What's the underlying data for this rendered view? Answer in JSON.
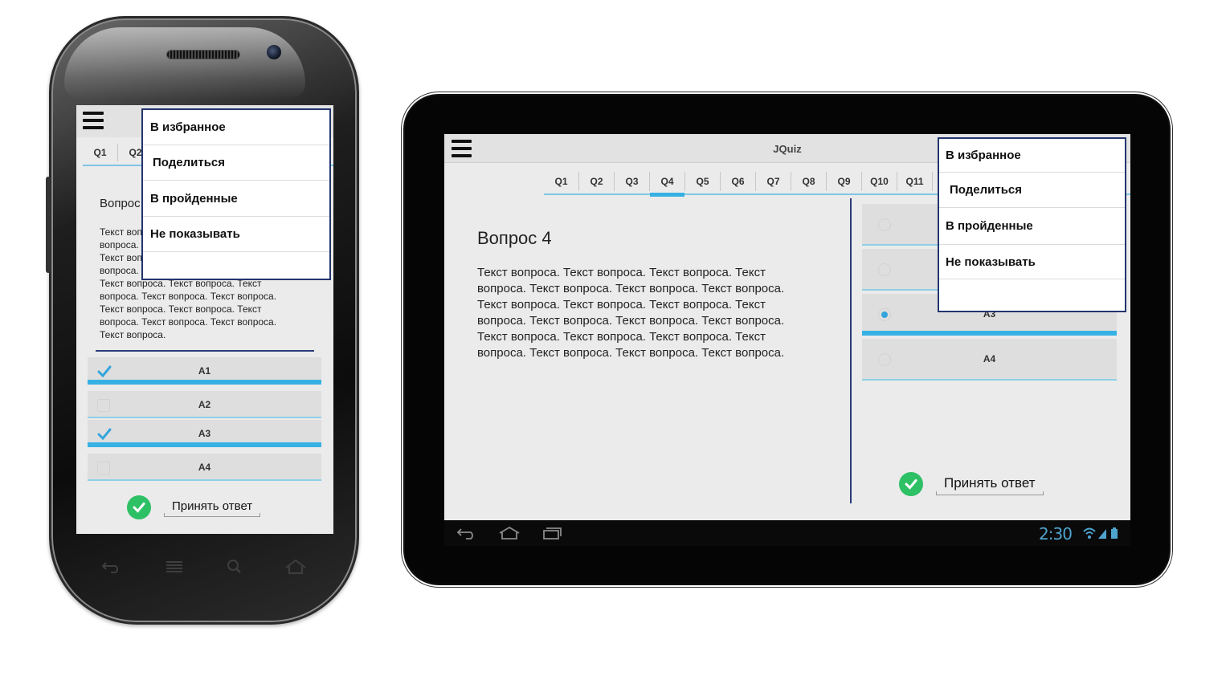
{
  "phone": {
    "tabs": [
      "Q1",
      "Q2"
    ],
    "question_title": "Вопрос",
    "question_text_lines": [
      "Текст воп",
      "вопроса.",
      "Текст воп",
      "вопроса.",
      "Текст вопроса. Текст вопроса. Текст",
      "вопроса. Текст вопроса. Текст вопроса.",
      "Текст вопроса. Текст вопроса. Текст",
      "вопроса. Текст вопроса. Текст вопроса.",
      "Текст вопроса."
    ],
    "answers": [
      {
        "label": "A1",
        "checked": true
      },
      {
        "label": "A2",
        "checked": false
      },
      {
        "label": "A3",
        "checked": true
      },
      {
        "label": "A4",
        "checked": false
      }
    ],
    "accept_label": "Принять ответ",
    "menu": [
      "В избранное",
      "Поделиться",
      "В пройденные",
      "Не показывать"
    ]
  },
  "tablet": {
    "app_title": "JQuiz",
    "tabs": [
      "Q1",
      "Q2",
      "Q3",
      "Q4",
      "Q5",
      "Q6",
      "Q7",
      "Q8",
      "Q9",
      "Q10",
      "Q11"
    ],
    "active_tab": "Q4",
    "question_title": "Вопрос 4",
    "question_text_lines": [
      "Текст вопроса. Текст вопроса. Текст вопроса. Текст",
      "вопроса. Текст вопроса. Текст вопроса. Текст вопроса.",
      "Текст вопроса. Текст вопроса. Текст вопроса. Текст",
      "вопроса. Текст вопроса. Текст вопроса. Текст вопроса.",
      "Текст вопроса. Текст вопроса. Текст вопроса. Текст",
      "вопроса. Текст вопроса. Текст вопроса. Текст вопроса."
    ],
    "answers": [
      {
        "label": "",
        "selected": false
      },
      {
        "label": "",
        "selected": false
      },
      {
        "label": "A3",
        "selected": true
      },
      {
        "label": "A4",
        "selected": false
      }
    ],
    "accept_label": "Принять ответ",
    "menu": [
      "В избранное",
      "Поделиться",
      "В пройденные",
      "Не показывать"
    ],
    "clock": "2:30"
  },
  "colors": {
    "accent_blue": "#37b1e3",
    "divider_navy": "#2b3b7a",
    "accept_green": "#2ec065",
    "menu_border": "#23356e",
    "clock_blue": "#4ea4cf"
  },
  "icons": [
    "hamburger-menu-icon",
    "checkmark-icon",
    "radio-button-icon",
    "check-circle-icon",
    "back-icon",
    "home-icon",
    "recent-apps-icon",
    "search-icon",
    "wifi-icon",
    "signal-icon",
    "battery-icon"
  ]
}
